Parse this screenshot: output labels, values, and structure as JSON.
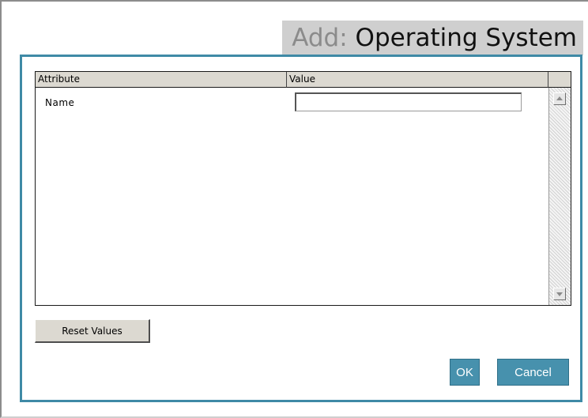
{
  "header": {
    "prefix": "Add:",
    "title": "Operating System"
  },
  "grid": {
    "columns": [
      "Attribute",
      "Value"
    ],
    "rows": [
      {
        "attribute": "Name",
        "value": ""
      }
    ]
  },
  "scrollbar": {
    "up_icon": "arrow-up-icon",
    "down_icon": "arrow-down-icon"
  },
  "buttons": {
    "reset": "Reset Values",
    "ok": "OK",
    "cancel": "Cancel"
  },
  "colors": {
    "accent": "#4791ad",
    "panel_border": "#3f8aa6",
    "title_bg": "#cfcfcf"
  }
}
